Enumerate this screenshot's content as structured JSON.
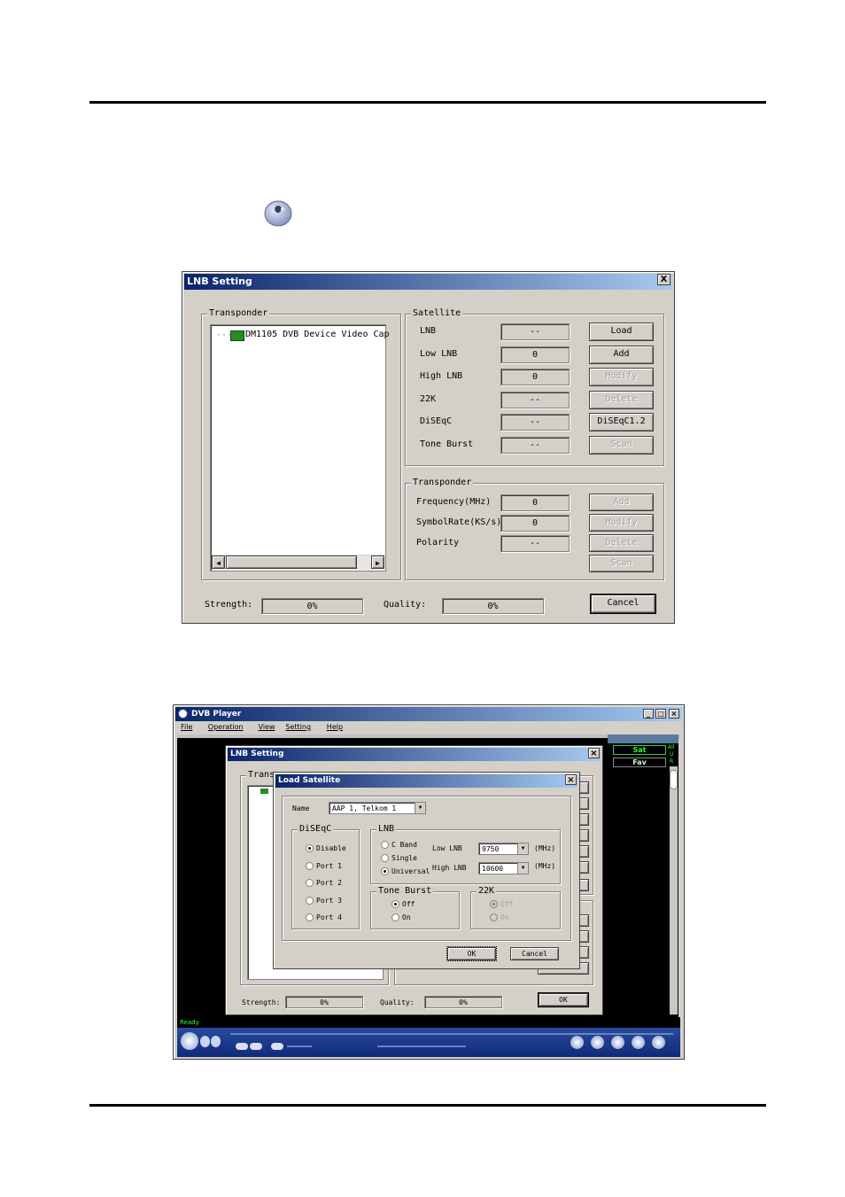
{
  "fig1": {
    "title": "LNB Setting",
    "close_label": "X",
    "transponder_group": "Transponder",
    "tree_item": "DM1105 DVB Device Video Cap",
    "satellite_group": "Satellite",
    "sat_rows": [
      {
        "label": "LNB",
        "value": "--",
        "button": "Load",
        "disabled": false
      },
      {
        "label": "Low LNB",
        "value": "0",
        "button": "Add",
        "disabled": false
      },
      {
        "label": "High LNB",
        "value": "0",
        "button": "Modify",
        "disabled": true
      },
      {
        "label": "22K",
        "value": "--",
        "button": "Delete",
        "disabled": true
      },
      {
        "label": "DiSEqC",
        "value": "--",
        "button": "DiSEqC1.2",
        "disabled": false
      },
      {
        "label": "Tone Burst",
        "value": "--",
        "button": "Scan",
        "disabled": true
      }
    ],
    "transponder_group2": "Transponder",
    "tp_rows": [
      {
        "label": "Frequency(MHz)",
        "value": "0",
        "button": "Add"
      },
      {
        "label": "SymbolRate(KS/s)",
        "value": "0",
        "button": "Modify"
      },
      {
        "label": "Polarity",
        "value": "--",
        "button": "Delete"
      },
      {
        "label": "",
        "value": "",
        "button": "Scan"
      }
    ],
    "strength_label": "Strength:",
    "strength_value": "0%",
    "quality_label": "Quality:",
    "quality_value": "0%",
    "cancel_button": "Cancel"
  },
  "fig2": {
    "player_title": "DVB Player",
    "menu": [
      "File",
      "Operation",
      "View",
      "Setting",
      "Help"
    ],
    "side_tabs": [
      "Sat",
      "Fav"
    ],
    "side_letters": [
      "All",
      "U",
      "R"
    ],
    "status": "Ready",
    "lnb_title": "LNB Setting",
    "lnb_group": "Transpo",
    "lnb_strength_label": "Strength:",
    "lnb_strength_value": "0%",
    "lnb_quality_label": "Quality:",
    "lnb_quality_value": "0%",
    "lnb_ok": "OK",
    "load_title": "Load Satellite",
    "name_label": "Name",
    "name_value": "AAP 1, Telkom 1",
    "diseqc_group": "DiSEqC",
    "diseqc_options": [
      "Disable",
      "Port 1",
      "Port 2",
      "Port 3",
      "Port 4"
    ],
    "lnb_group2": "LNB",
    "lnb_options": [
      "C Band",
      "Single",
      "Universal"
    ],
    "low_lnb_label": "Low LNB",
    "low_lnb_value": "9750",
    "high_lnb_label": "High LNB",
    "high_lnb_value": "10600",
    "mhz_label": "(MHz)",
    "toneburst_group": "Tone Burst",
    "toneburst_options": [
      "Off",
      "On"
    ],
    "k22_group": "22K",
    "k22_options": [
      "Off",
      "On"
    ],
    "ok_button": "OK",
    "cancel_button": "Cancel"
  }
}
